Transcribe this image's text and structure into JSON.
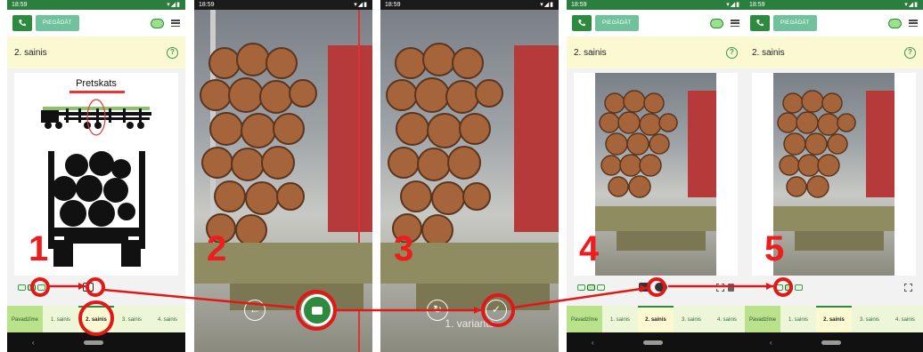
{
  "status_time": "18:59",
  "appbar": {
    "preview_label": "PIEGĀDĀT"
  },
  "title": "2. sainis",
  "diagram_title": "Pretskats",
  "tabs": [
    "Pavadzīme",
    "1. sainis",
    "2. sainis",
    "3. sainis",
    "4. sainis"
  ],
  "active_tab": "2. sainis",
  "variant_caption": "1. variants",
  "steps": [
    "1",
    "2",
    "3",
    "4",
    "5"
  ],
  "colors": {
    "brand_green": "#2e8b3d",
    "highlight_red": "#e01818",
    "title_bg": "#fbf9d2",
    "tab_bg": "#eef6d8"
  }
}
